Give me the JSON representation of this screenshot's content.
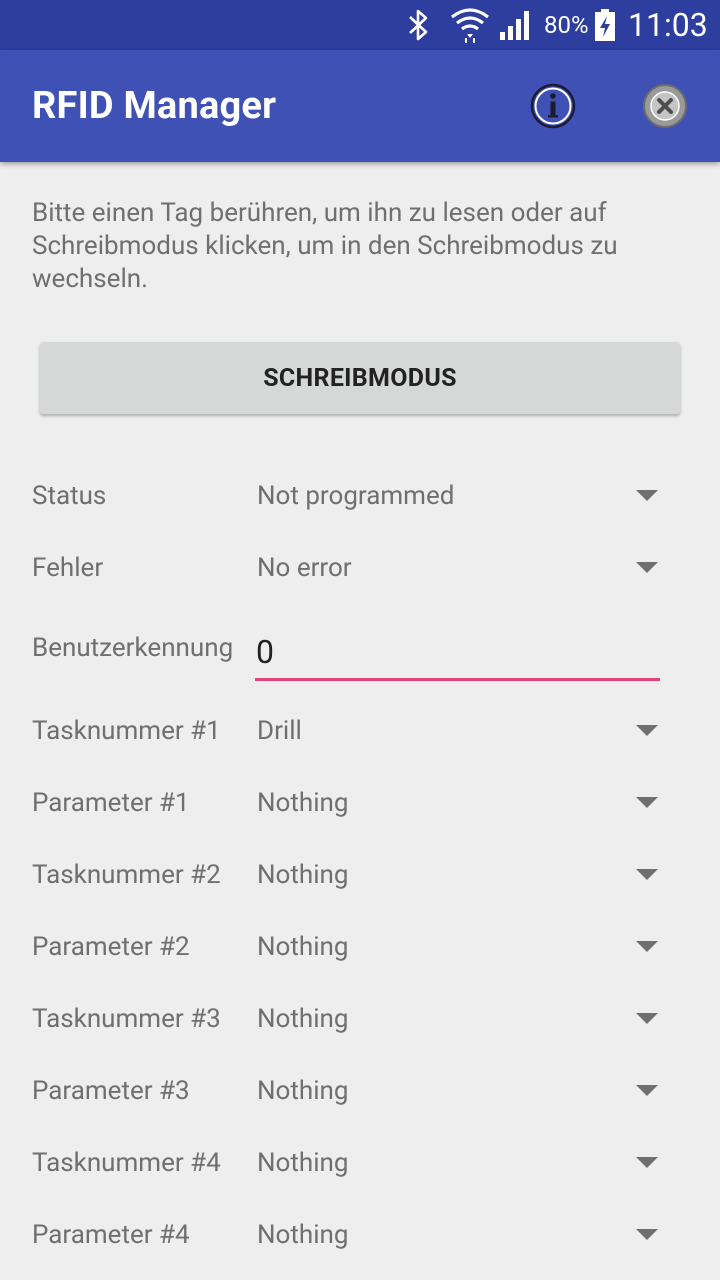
{
  "status_bar": {
    "battery_percent": "80%",
    "time": "11:03",
    "icons": [
      "bluetooth-icon",
      "wifi-icon",
      "signal-icon",
      "battery-charging-icon"
    ],
    "color": "#2e3e9e"
  },
  "app_bar": {
    "title": "RFID Manager",
    "actions": [
      "info-icon",
      "close-circle-icon"
    ],
    "color": "#3f51b5"
  },
  "instructions": "Bitte einen Tag berühren, um ihn zu lesen oder auf Schreibmodus klicken, um in den Schreibmodus zu wechseln.",
  "mode_button": {
    "label": "SCHREIBMODUS"
  },
  "fields": {
    "status": {
      "label": "Status",
      "value": "Not programmed"
    },
    "error": {
      "label": "Fehler",
      "value": "No error"
    },
    "user_id": {
      "label": "Benutzerkennung",
      "value": "0",
      "underline_color": "#e0447a"
    },
    "task1": {
      "label": "Tasknummer #1",
      "value": "Drill"
    },
    "param1": {
      "label": "Parameter #1",
      "value": "Nothing"
    },
    "task2": {
      "label": "Tasknummer #2",
      "value": "Nothing"
    },
    "param2": {
      "label": "Parameter #2",
      "value": "Nothing"
    },
    "task3": {
      "label": "Tasknummer #3",
      "value": "Nothing"
    },
    "param3": {
      "label": "Parameter #3",
      "value": "Nothing"
    },
    "task4": {
      "label": "Tasknummer #4",
      "value": "Nothing"
    },
    "param4": {
      "label": "Parameter #4",
      "value": "Nothing"
    }
  }
}
